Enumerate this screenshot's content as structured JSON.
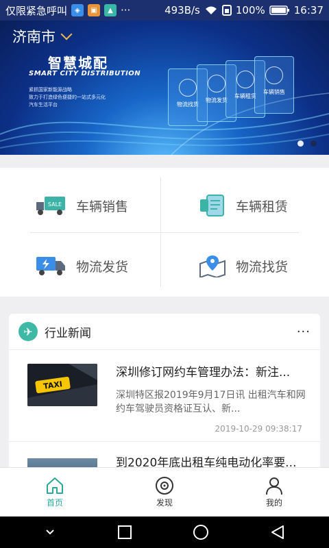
{
  "status_bar": {
    "carrier": "仅限紧急呼叫",
    "more": "···",
    "net_speed": "493B/s",
    "battery": "100%",
    "time": "16:37"
  },
  "banner": {
    "city": "济南市",
    "title": "智慧城配",
    "subtitle": "SMART CITY DISTRIBUTION",
    "desc_lines": [
      "紧抓国家新能源战略",
      "致力于打造绿色便捷的一站式多元化",
      "汽车生活平台"
    ],
    "panels": [
      "物流找货",
      "物流发货",
      "车辆租赁",
      "车辆销售"
    ]
  },
  "services": [
    {
      "label": "车辆销售",
      "icon": "truck-sale-icon"
    },
    {
      "label": "车辆租赁",
      "icon": "rental-doc-icon"
    },
    {
      "label": "物流发货",
      "icon": "lightning-truck-icon"
    },
    {
      "label": "物流找货",
      "icon": "map-pin-icon"
    }
  ],
  "news": {
    "header": "行业新闻",
    "more": "···",
    "items": [
      {
        "title": "深圳修订网约车管理办法：新注...",
        "desc": "深圳特区报2019年9月17日讯 出租汽车和网约车驾驶员资格证互认、新...",
        "date": "2019-10-29 09:38:17",
        "thumb_text": "TAXI"
      },
      {
        "title": "到2020年底出租车纯电动化率要..."
      }
    ]
  },
  "tabs": [
    {
      "label": "首页",
      "icon": "home-icon",
      "active": true
    },
    {
      "label": "发现",
      "icon": "discover-icon",
      "active": false
    },
    {
      "label": "我的",
      "icon": "profile-icon",
      "active": false
    }
  ],
  "colors": {
    "accent": "#2aa99a",
    "status_bg": "#1c2f6e",
    "taxi_yellow": "#f7c600"
  }
}
